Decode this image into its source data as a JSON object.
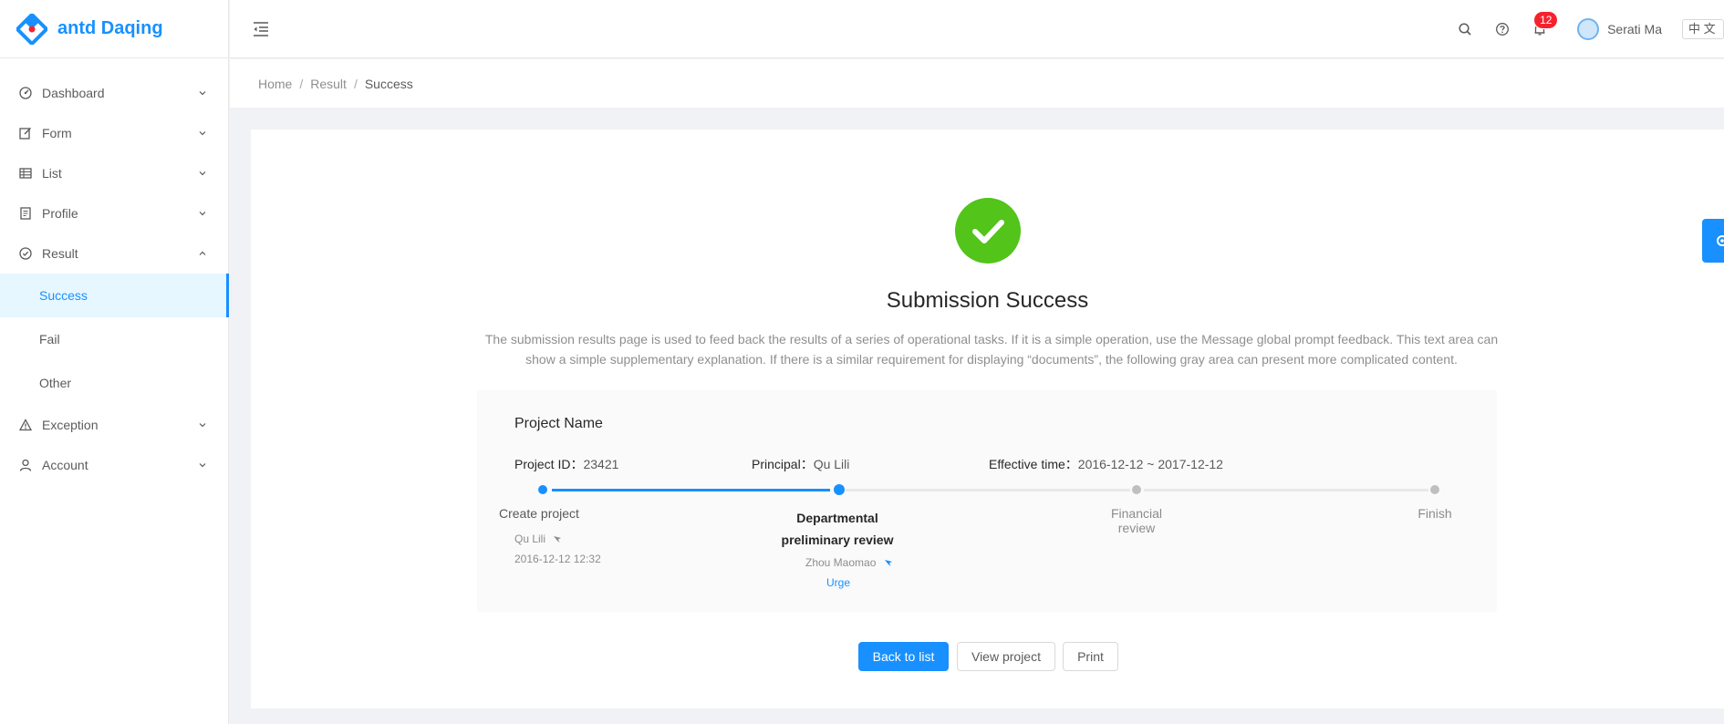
{
  "app": {
    "title": "antd Daqing",
    "brand_color": "#1890ff"
  },
  "sidebar": {
    "items": [
      {
        "label": "Dashboard",
        "icon": "dashboard-icon"
      },
      {
        "label": "Form",
        "icon": "edit-icon"
      },
      {
        "label": "List",
        "icon": "table-icon"
      },
      {
        "label": "Profile",
        "icon": "profile-icon"
      },
      {
        "label": "Result",
        "icon": "check-circle-icon",
        "expanded": true,
        "children": [
          {
            "label": "Success",
            "active": true
          },
          {
            "label": "Fail"
          },
          {
            "label": "Other"
          }
        ]
      },
      {
        "label": "Exception",
        "icon": "warning-icon"
      },
      {
        "label": "Account",
        "icon": "user-icon"
      }
    ]
  },
  "header": {
    "notification_count": "12",
    "user_name": "Serati Ma",
    "lang_label": "中 文"
  },
  "breadcrumb": [
    "Home",
    "Result",
    "Success"
  ],
  "result": {
    "title": "Submission Success",
    "status_color": "#52c41a",
    "description": "The submission results page is used to feed back the results of a series of operational tasks. If it is a simple operation, use the Message global prompt feedback. This text area can show a simple supplementary explanation. If there is a similar requirement for displaying “documents”, the following gray area can present more complicated content."
  },
  "project": {
    "name": "Project Name",
    "id_label": "Project ID：",
    "id_value": "23421",
    "principal_label": "Principal：",
    "principal_value": "Qu Lili",
    "time_label": "Effective time：",
    "time_value": "2016-12-12 ~ 2017-12-12"
  },
  "steps": [
    {
      "title": "Create project",
      "person": "Qu Lili",
      "time": "2016-12-12 12:32",
      "status": "finish"
    },
    {
      "title_line1": "Departmental",
      "title_line2": "preliminary review",
      "person": "Zhou Maomao",
      "action": "Urge",
      "status": "process"
    },
    {
      "title": "Financial review",
      "status": "wait"
    },
    {
      "title": "Finish",
      "status": "wait"
    }
  ],
  "actions": {
    "back": "Back to list",
    "view": "View project",
    "print": "Print"
  }
}
